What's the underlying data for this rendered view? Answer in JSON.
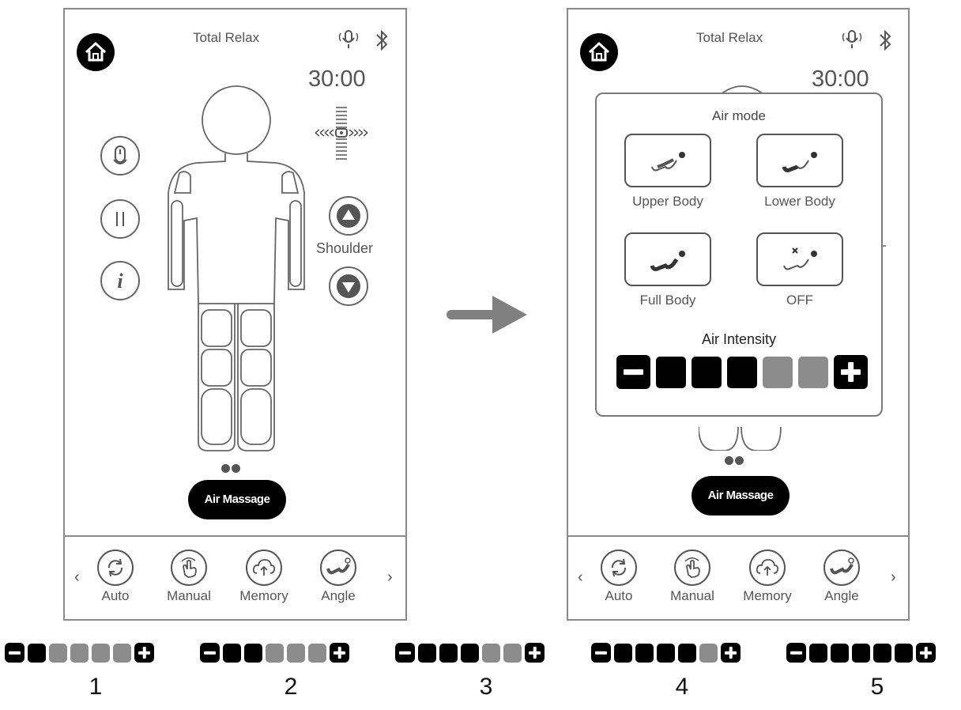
{
  "left_screen": {
    "title": "Total Relax",
    "timer": "30:00",
    "shoulder_label": "Shoulder",
    "air_button": "Air Massage",
    "nav": [
      "Auto",
      "Manual",
      "Memory",
      "Angle"
    ],
    "icons": [
      "home-icon",
      "voice-icon",
      "bluetooth-icon",
      "mic-icon",
      "pause-icon",
      "info-icon",
      "roller-position-icon",
      "arrow-up-icon",
      "arrow-down-icon"
    ]
  },
  "right_screen": {
    "title": "Total Relax",
    "timer": "30:00",
    "air_button": "Air Massage",
    "nav": [
      "Auto",
      "Manual",
      "Memory",
      "Angle"
    ],
    "popup": {
      "title": "Air mode",
      "modes": [
        "Upper Body",
        "Lower Body",
        "Full Body",
        "OFF"
      ],
      "intensity_label": "Air Intensity",
      "intensity_level": 3,
      "intensity_max": 5
    }
  },
  "levels": [
    {
      "caption": "1",
      "level": 1
    },
    {
      "caption": "2",
      "level": 2
    },
    {
      "caption": "3",
      "level": 3
    },
    {
      "caption": "4",
      "level": 4
    },
    {
      "caption": "5",
      "level": 5
    }
  ],
  "colors": {
    "segment_on": "#000000",
    "segment_off": "#8c8c8c",
    "accent": "#000000"
  }
}
